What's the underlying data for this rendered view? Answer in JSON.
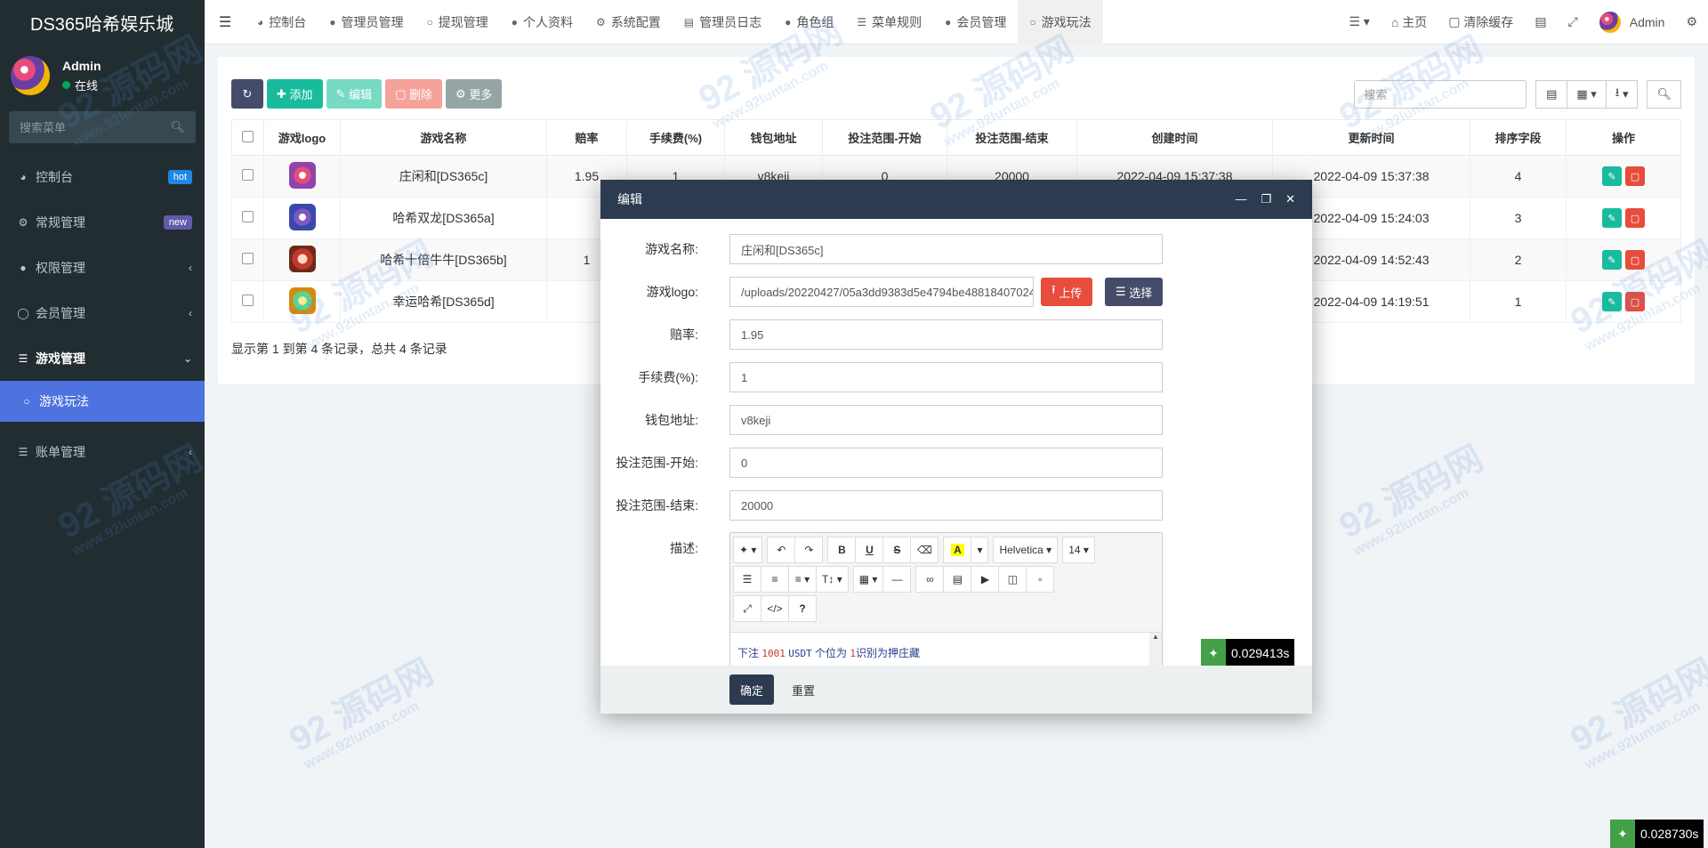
{
  "sidebar": {
    "brand": "DS365哈希娱乐城",
    "user": {
      "name": "Admin",
      "status": "在线"
    },
    "search_placeholder": "搜索菜单",
    "items": [
      {
        "label": "控制台",
        "badge": "hot"
      },
      {
        "label": "常规管理",
        "badge": "new"
      },
      {
        "label": "权限管理"
      },
      {
        "label": "会员管理"
      },
      {
        "label": "游戏管理"
      },
      {
        "label": "游戏玩法"
      },
      {
        "label": "账单管理"
      }
    ]
  },
  "topnav": {
    "tabs": [
      "控制台",
      "管理员管理",
      "提现管理",
      "个人资料",
      "系统配置",
      "管理员日志",
      "角色组",
      "菜单规则",
      "会员管理",
      "游戏玩法"
    ],
    "home": "主页",
    "clear_cache": "清除缓存",
    "user": "Admin"
  },
  "toolbar": {
    "add": "添加",
    "edit": "编辑",
    "delete": "删除",
    "more": "更多",
    "search_placeholder": "搜索"
  },
  "table": {
    "columns": [
      "游戏logo",
      "游戏名称",
      "赔率",
      "手续费(%)",
      "钱包地址",
      "投注范围-开始",
      "投注范围-结束",
      "创建时间",
      "更新时间",
      "排序字段",
      "操作"
    ],
    "op_header": "操作",
    "rows": [
      {
        "name": "庄闲和[DS365c]",
        "odds": "1.95",
        "fee": "1",
        "wallet": "v8keji",
        "start": "0",
        "end": "20000",
        "created": "2022-04-09 15:37:38",
        "updated": "2022-04-09 15:37:38",
        "sort": "4"
      },
      {
        "name": "哈希双龙[DS365a]",
        "odds": "",
        "fee": "",
        "wallet": "",
        "start": "",
        "end": "",
        "created": "",
        "updated": "2022-04-09 15:24:03",
        "sort": "3"
      },
      {
        "name": "哈希十倍牛牛[DS365b]",
        "odds": "1",
        "fee": "",
        "wallet": "",
        "start": "",
        "end": "",
        "created": "",
        "updated": "2022-04-09 14:52:43",
        "sort": "2"
      },
      {
        "name": "幸运哈希[DS365d]",
        "odds": "",
        "fee": "",
        "wallet": "",
        "start": "",
        "end": "",
        "created": "",
        "updated": "2022-04-09 14:19:51",
        "sort": "1"
      }
    ],
    "summary": "显示第 1 到第 4 条记录，总共 4 条记录"
  },
  "modal": {
    "title": "编辑",
    "fields": {
      "name_label": "游戏名称:",
      "name": "庄闲和[DS365c]",
      "logo_label": "游戏logo:",
      "logo": "/uploads/20220427/05a3dd9383d5e4794be48818407024",
      "upload": "上传",
      "choose": "选择",
      "odds_label": "赔率:",
      "odds": "1.95",
      "fee_label": "手续费(%):",
      "fee": "1",
      "wallet_label": "钱包地址:",
      "wallet": "v8keji",
      "start_label": "投注范围-开始:",
      "start": "0",
      "end_label": "投注范围-结束:",
      "end": "20000",
      "desc_label": "描述:"
    },
    "editor": {
      "font": "Helvetica",
      "size": "14",
      "content_prefix": "下注",
      "content_amount": "100",
      "content_one": "1",
      "content_usdt": "USDT",
      "content_mid": "个位为",
      "content_digit": "1",
      "content_suffix": "识别为押庄藏"
    },
    "ok": "确定",
    "reset": "重置",
    "timer": "0.029413s"
  },
  "page_timer": "0.028730s",
  "watermark": {
    "main": "92 源码网",
    "sub": "www.92luntan.com"
  }
}
